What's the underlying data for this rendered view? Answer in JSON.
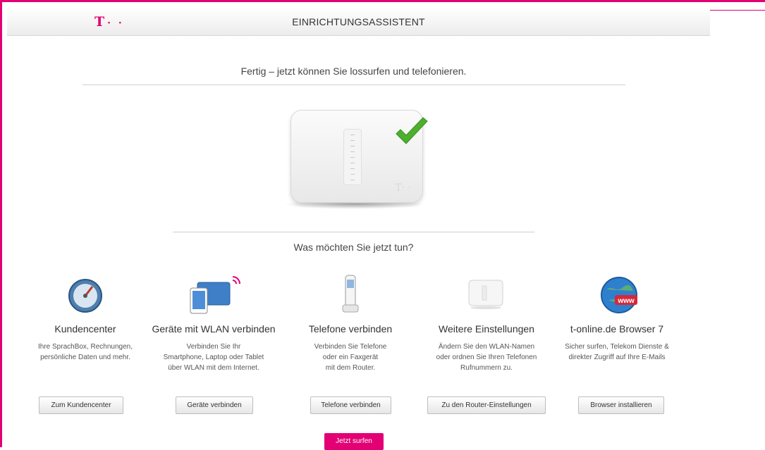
{
  "header": {
    "logo": "T",
    "logo_dots": "· ·",
    "title": "EINRICHTUNGSASSISTENT"
  },
  "main": {
    "heading": "Fertig – jetzt können Sie lossurfen und telefonieren.",
    "router_logo": "T· ·",
    "question": "Was möchten Sie jetzt tun?"
  },
  "options": [
    {
      "title": "Kundencenter",
      "desc": [
        "Ihre SprachBox, Rechnungen,",
        "persönliche Daten und mehr."
      ],
      "button": "Zum Kundencenter",
      "icon": "speedometer-icon"
    },
    {
      "title": "Geräte mit WLAN verbinden",
      "desc": [
        "Verbinden Sie Ihr",
        "Smartphone, Laptop oder Tablet",
        "über WLAN mit dem Internet."
      ],
      "button": "Geräte verbinden",
      "icon": "devices-wlan-icon"
    },
    {
      "title": "Telefone verbinden",
      "desc": [
        "Verbinden Sie Telefone",
        "oder ein Faxgerät",
        "mit dem Router."
      ],
      "button": "Telefone verbinden",
      "icon": "cordless-phone-icon"
    },
    {
      "title": "Weitere Einstellungen",
      "desc": [
        "Ändern Sie den WLAN-Namen",
        "oder ordnen Sie Ihren Telefonen",
        "Rufnummern zu."
      ],
      "button": "Zu den Router-Einstellungen",
      "icon": "router-icon"
    },
    {
      "title": "t-online.de Browser 7",
      "desc": [
        "Sicher surfen, Telekom Dienste &",
        "direkter Zugriff auf Ihre E-Mails"
      ],
      "button": "Browser installieren",
      "icon": "globe-www-icon",
      "badge": "www"
    }
  ],
  "primary_button": "Jetzt surfen",
  "colors": {
    "brand": "#e20074",
    "check": "#4caf2e"
  }
}
